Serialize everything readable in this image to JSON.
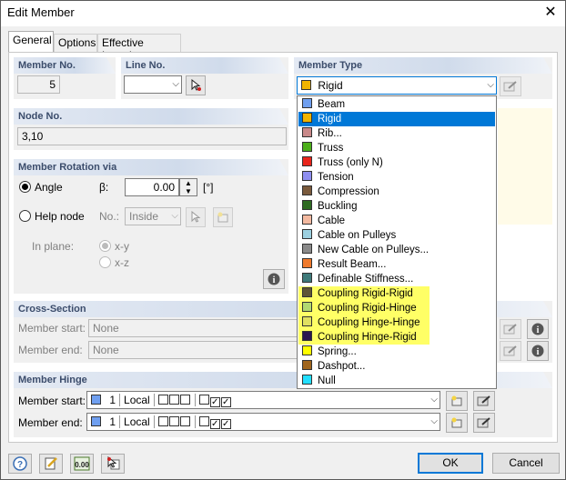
{
  "window": {
    "title": "Edit Member",
    "close": "✕"
  },
  "tabs": [
    {
      "label": "General",
      "active": true
    },
    {
      "label": "Options",
      "active": false
    },
    {
      "label": "Effective Lengths",
      "active": false
    }
  ],
  "member_no": {
    "label": "Member No.",
    "value": "5"
  },
  "line_no": {
    "label": "Line No.",
    "value": ""
  },
  "member_type": {
    "label": "Member Type",
    "value": "Rigid",
    "value_color": "#f0b400",
    "options": [
      {
        "label": "Beam",
        "color": "#6f9ff0",
        "state": "normal"
      },
      {
        "label": "Rigid",
        "color": "#f0b400",
        "state": "selected"
      },
      {
        "label": "Rib...",
        "color": "#c98989",
        "state": "normal"
      },
      {
        "label": "Truss",
        "color": "#4caf1a",
        "state": "normal"
      },
      {
        "label": "Truss (only N)",
        "color": "#e8251b",
        "state": "normal"
      },
      {
        "label": "Tension",
        "color": "#8e8ef0",
        "state": "normal"
      },
      {
        "label": "Compression",
        "color": "#7a5a3c",
        "state": "normal"
      },
      {
        "label": "Buckling",
        "color": "#2f6b22",
        "state": "normal"
      },
      {
        "label": "Cable",
        "color": "#f3b9a0",
        "state": "normal"
      },
      {
        "label": "Cable on Pulleys",
        "color": "#9cd0e0",
        "state": "normal"
      },
      {
        "label": "New Cable on Pulleys...",
        "color": "#8a8a8a",
        "state": "normal"
      },
      {
        "label": "Result Beam...",
        "color": "#f07a2c",
        "state": "normal"
      },
      {
        "label": "Definable Stiffness...",
        "color": "#3e7a7a",
        "state": "normal"
      },
      {
        "label": "Coupling Rigid-Rigid",
        "color": "#5f5536",
        "state": "highlight"
      },
      {
        "label": "Coupling Rigid-Hinge",
        "color": "#b0d870",
        "state": "highlight"
      },
      {
        "label": "Coupling Hinge-Hinge",
        "color": "#e0e060",
        "state": "highlight"
      },
      {
        "label": "Coupling Hinge-Rigid",
        "color": "#2a1550",
        "state": "highlight"
      },
      {
        "label": "Spring...",
        "color": "#ffff00",
        "state": "normal"
      },
      {
        "label": "Dashpot...",
        "color": "#a0651c",
        "state": "normal"
      },
      {
        "label": "Null",
        "color": "#22dfff",
        "state": "normal"
      }
    ]
  },
  "node_no": {
    "label": "Node No.",
    "value": "3,10"
  },
  "rotation": {
    "label": "Member Rotation via",
    "angle_label": "Angle",
    "beta_label": "β:",
    "beta_value": "0.00",
    "unit": "[°]",
    "help_node_label": "Help node",
    "no_label": "No.:",
    "inside_value": "Inside",
    "in_plane_label": "In plane:",
    "xy_label": "x-y",
    "xz_label": "x-z"
  },
  "cross_section": {
    "label": "Cross-Section",
    "start_label": "Member start:",
    "start_value": "None",
    "end_label": "Member end:",
    "end_value": "None"
  },
  "hinge": {
    "label": "Member Hinge",
    "start_label": "Member start:",
    "end_label": "Member end:",
    "value_num": "1",
    "value_type": "Local",
    "value_color": "#6f9ff0"
  },
  "buttons": {
    "ok": "OK",
    "cancel": "Cancel"
  }
}
